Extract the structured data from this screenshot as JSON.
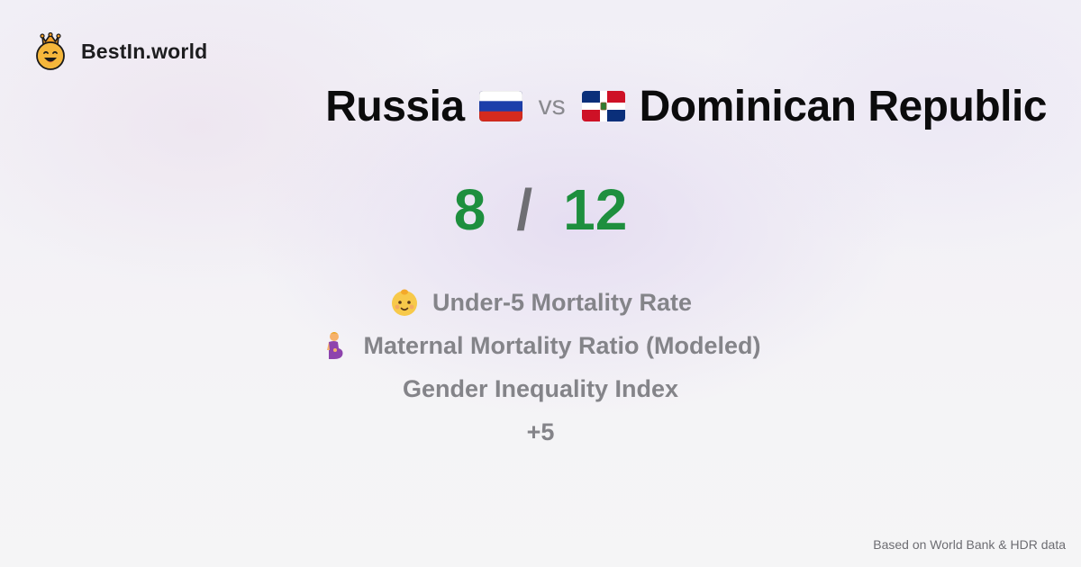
{
  "brand": {
    "name": "BestIn.world",
    "logo_icon": "crown-smiley-icon"
  },
  "title": {
    "left_country": "Russia",
    "left_flag_icon": "russia-flag-icon",
    "vs_text": "vs",
    "right_country": "Dominican Republic",
    "right_flag_icon": "dominican-republic-flag-icon"
  },
  "scores": {
    "left": "8",
    "separator": "/",
    "right": "12",
    "color": "#1e8f3e"
  },
  "metrics": [
    {
      "label": "Under-5 Mortality Rate",
      "icon": "baby-icon"
    },
    {
      "label": "Maternal Mortality Ratio (Modeled)",
      "icon": "pregnant-woman-icon"
    },
    {
      "label": "Gender Inequality Index",
      "icon": ""
    },
    {
      "label": "+5",
      "icon": ""
    }
  ],
  "footer": {
    "source_text": "Based on World Bank & HDR data"
  }
}
